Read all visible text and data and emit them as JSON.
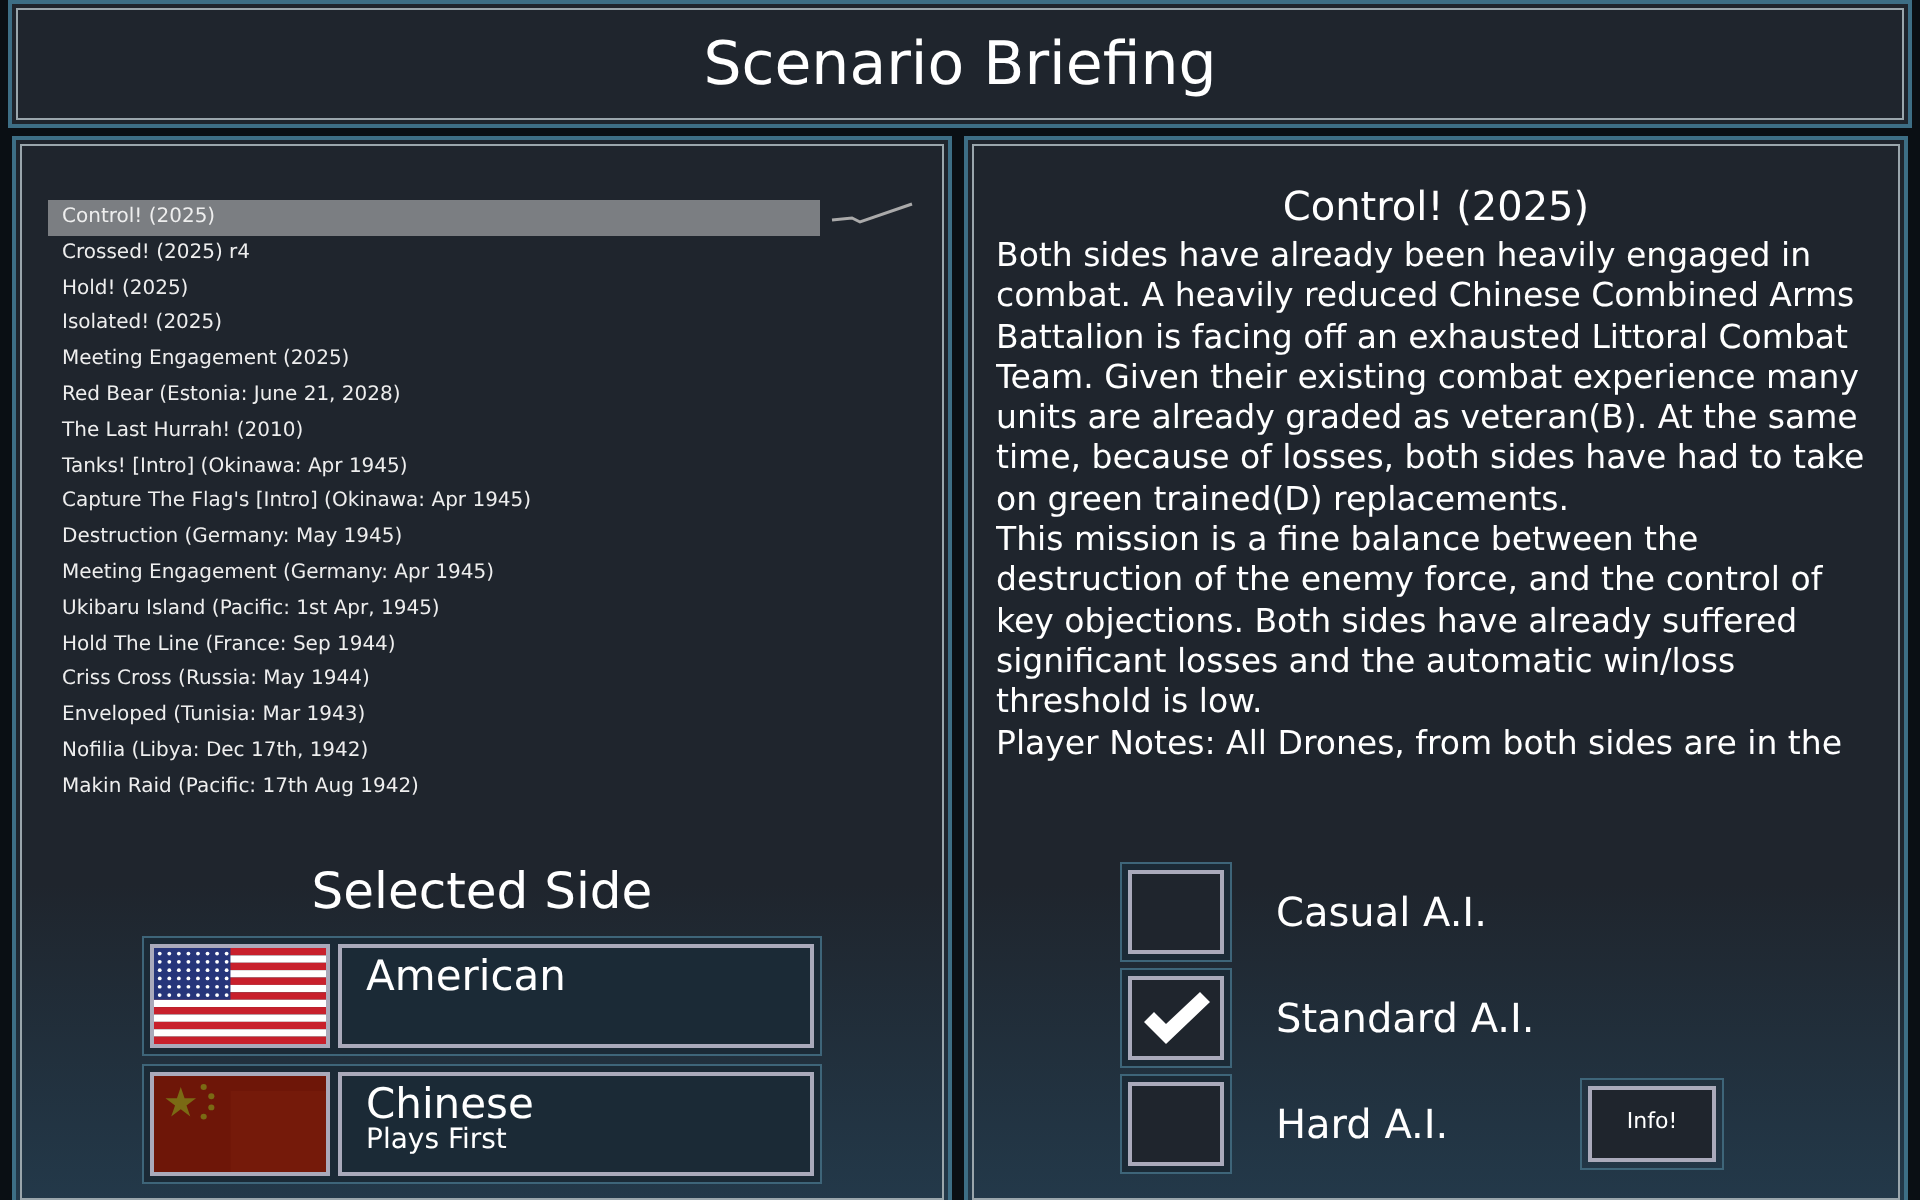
{
  "window": {
    "title": "Scenario Briefing"
  },
  "scenarios": [
    {
      "label": "Control! (2025)",
      "selected": true
    },
    {
      "label": "Crossed! (2025) r4",
      "selected": false
    },
    {
      "label": "Hold! (2025)",
      "selected": false
    },
    {
      "label": "Isolated! (2025)",
      "selected": false
    },
    {
      "label": "Meeting Engagement (2025)",
      "selected": false
    },
    {
      "label": "Red Bear (Estonia: June 21, 2028)",
      "selected": false
    },
    {
      "label": "The Last Hurrah! (2010)",
      "selected": false
    },
    {
      "label": "Tanks! [Intro] (Okinawa: Apr 1945)",
      "selected": false
    },
    {
      "label": "Capture The Flag's [Intro] (Okinawa: Apr 1945)",
      "selected": false
    },
    {
      "label": "Destruction (Germany: May 1945)",
      "selected": false
    },
    {
      "label": "Meeting Engagement (Germany: Apr 1945)",
      "selected": false
    },
    {
      "label": "Ukibaru Island (Pacific: 1st Apr, 1945)",
      "selected": false
    },
    {
      "label": "Hold The Line (France: Sep 1944)",
      "selected": false
    },
    {
      "label": "Criss Cross (Russia: May 1944)",
      "selected": false
    },
    {
      "label": "Enveloped (Tunisia: Mar 1943)",
      "selected": false
    },
    {
      "label": "Nofilia (Libya: Dec 17th, 1942)",
      "selected": false
    },
    {
      "label": "Makin Raid (Pacific: 17th Aug 1942)",
      "selected": false
    }
  ],
  "selected_side": {
    "heading": "Selected Side",
    "sides": [
      {
        "kind": "stripes",
        "name": "American"
      },
      {
        "kind": "stars",
        "name": "Chinese",
        "note": "Plays First"
      }
    ]
  },
  "briefing": {
    "title": "Control! (2025)",
    "paragraphs": [
      "Both sides have already been heavily engaged in combat.  A heavily reduced Chinese Combined Arms Battalion is facing off an exhausted Littoral Combat Team.  Given their existing combat experience many units are already graded as veteran(B).  At the same time, because of losses, both sides have had to take on green trained(D) replacements.",
      "This mission is a fine balance between the destruction of the enemy force, and the control of key objections.  Both sides have already suffered significant losses and the automatic win/loss threshold is low.",
      "Player Notes: All Drones, from both sides are in the"
    ]
  },
  "ai_levels": [
    {
      "label": "Casual A.I.",
      "checked": false
    },
    {
      "label": "Standard A.I.",
      "checked": true
    },
    {
      "label": "Hard A.I.",
      "checked": false
    }
  ],
  "info_button": "Info!"
}
